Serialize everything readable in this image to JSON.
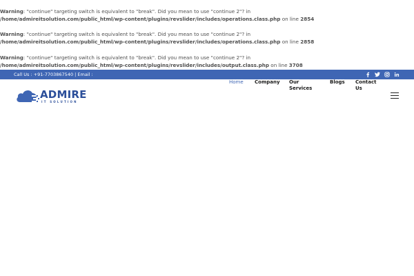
{
  "warnings": [
    {
      "label": "Warning",
      "message": ": \"continue\" targeting switch is equivalent to \"break\". Did you mean to use \"continue 2\"? in ",
      "path": "/home/admireitsolution.com/public_html/wp-content/plugins/revslider/includes/operations.class.php",
      "on_line": " on line ",
      "line": "2854"
    },
    {
      "label": "Warning",
      "message": ": \"continue\" targeting switch is equivalent to \"break\". Did you mean to use \"continue 2\"? in ",
      "path": "/home/admireitsolution.com/public_html/wp-content/plugins/revslider/includes/operations.class.php",
      "on_line": " on line ",
      "line": "2858"
    },
    {
      "label": "Warning",
      "message": ": \"continue\" targeting switch is equivalent to \"break\". Did you mean to use \"continue 2\"? in ",
      "path": "/home/admireitsolution.com/public_html/wp-content/plugins/revslider/includes/output.class.php",
      "on_line": " on line ",
      "line": "3708"
    }
  ],
  "topbar": {
    "contact_text": "Call Us : +91-7703867540 | Email :",
    "social": [
      "f",
      "t",
      "ig",
      "in"
    ],
    "social_names": [
      "facebook-icon",
      "twitter-icon",
      "instagram-icon",
      "linkedin-icon"
    ],
    "background": "#3f66b4"
  },
  "logo": {
    "word": "ADMIRE",
    "tagline": "IT SOLUTION",
    "brand_color": "#2c4f9a"
  },
  "nav": {
    "items": [
      {
        "label": "Home",
        "active": true
      },
      {
        "label": "Company",
        "active": false
      },
      {
        "label": "Our Services",
        "active": false
      },
      {
        "label": "Blogs",
        "active": false
      },
      {
        "label": "Contact Us",
        "active": false
      }
    ],
    "active_color": "#3f66b4"
  },
  "menu_toggle": "hamburger-icon"
}
